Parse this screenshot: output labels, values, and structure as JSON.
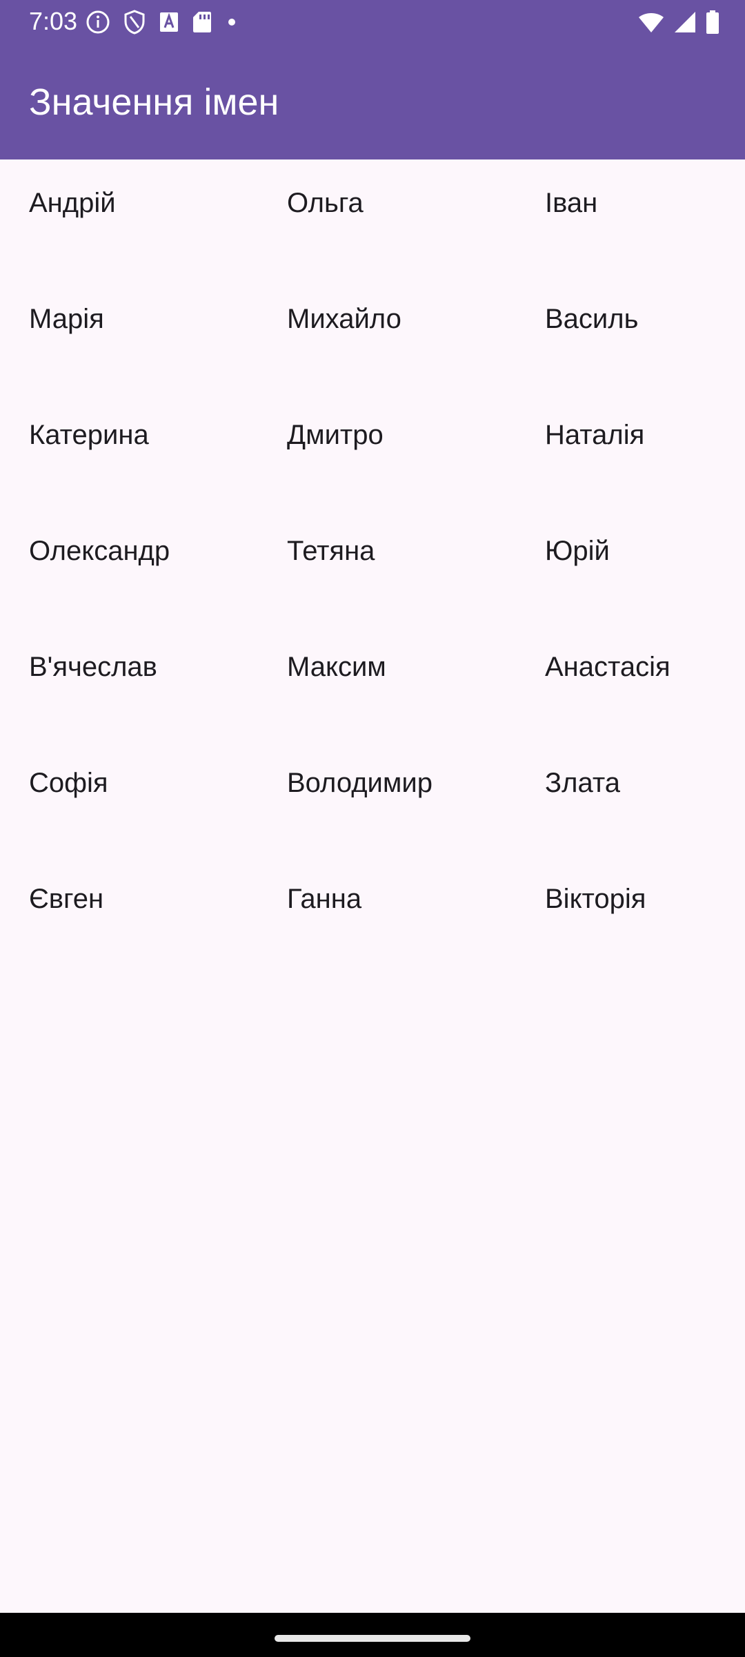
{
  "status_bar": {
    "time": "7:03",
    "left_icons": [
      "info-icon",
      "shield-icon",
      "font-a-icon",
      "sd-card-icon",
      "dot-icon"
    ],
    "right_icons": [
      "wifi-icon",
      "cell-signal-icon",
      "battery-icon"
    ]
  },
  "app_bar": {
    "title": "Значення імен",
    "color": "#6952A3"
  },
  "names": [
    {
      "label": "Андрій"
    },
    {
      "label": "Ольга"
    },
    {
      "label": "Іван"
    },
    {
      "label": "Марія"
    },
    {
      "label": "Михайло"
    },
    {
      "label": "Василь"
    },
    {
      "label": "Катерина"
    },
    {
      "label": "Дмитро"
    },
    {
      "label": "Наталія"
    },
    {
      "label": "Олександр"
    },
    {
      "label": "Тетяна"
    },
    {
      "label": "Юрій"
    },
    {
      "label": "В'ячеслав"
    },
    {
      "label": "Максим"
    },
    {
      "label": "Анастасія"
    },
    {
      "label": "Софія"
    },
    {
      "label": "Володимир"
    },
    {
      "label": "Злата"
    },
    {
      "label": "Євген"
    },
    {
      "label": "Ганна"
    },
    {
      "label": "Вікторія"
    }
  ],
  "colors": {
    "background": "#FDF7FC",
    "text": "#1D1B20",
    "nav_bar": "#000000"
  }
}
